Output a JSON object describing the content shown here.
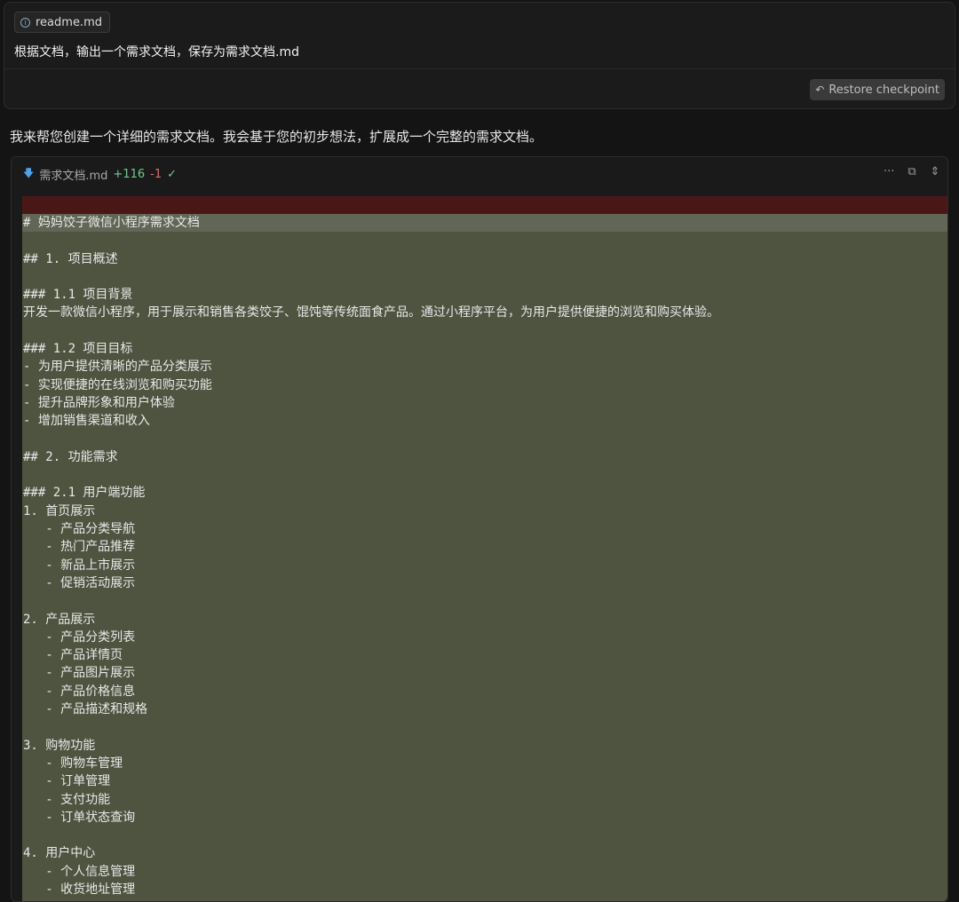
{
  "prompt": {
    "context_file": "readme.md",
    "text": "根据文档，输出一个需求文档，保存为需求文档.md",
    "restore_label": "Restore checkpoint"
  },
  "assistant": {
    "message": "我来帮您创建一个详细的需求文档。我会基于您的初步想法，扩展成一个完整的需求文档。"
  },
  "editor": {
    "file_name": "需求文档.md",
    "added": "+116",
    "removed": "-1",
    "lines": [
      "# 妈妈饺子微信小程序需求文档",
      "",
      "## 1. 项目概述",
      "",
      "### 1.1 项目背景",
      "开发一款微信小程序，用于展示和销售各类饺子、馄饨等传统面食产品。通过小程序平台，为用户提供便捷的浏览和购买体验。",
      "",
      "### 1.2 项目目标",
      "- 为用户提供清晰的产品分类展示",
      "- 实现便捷的在线浏览和购买功能",
      "- 提升品牌形象和用户体验",
      "- 增加销售渠道和收入",
      "",
      "## 2. 功能需求",
      "",
      "### 2.1 用户端功能",
      "1. 首页展示",
      "   - 产品分类导航",
      "   - 热门产品推荐",
      "   - 新品上市展示",
      "   - 促销活动展示",
      "",
      "2. 产品展示",
      "   - 产品分类列表",
      "   - 产品详情页",
      "   - 产品图片展示",
      "   - 产品价格信息",
      "   - 产品描述和规格",
      "",
      "3. 购物功能",
      "   - 购物车管理",
      "   - 订单管理",
      "   - 支付功能",
      "   - 订单状态查询",
      "",
      "4. 用户中心",
      "   - 个人信息管理",
      "   - 收货地址管理"
    ]
  }
}
